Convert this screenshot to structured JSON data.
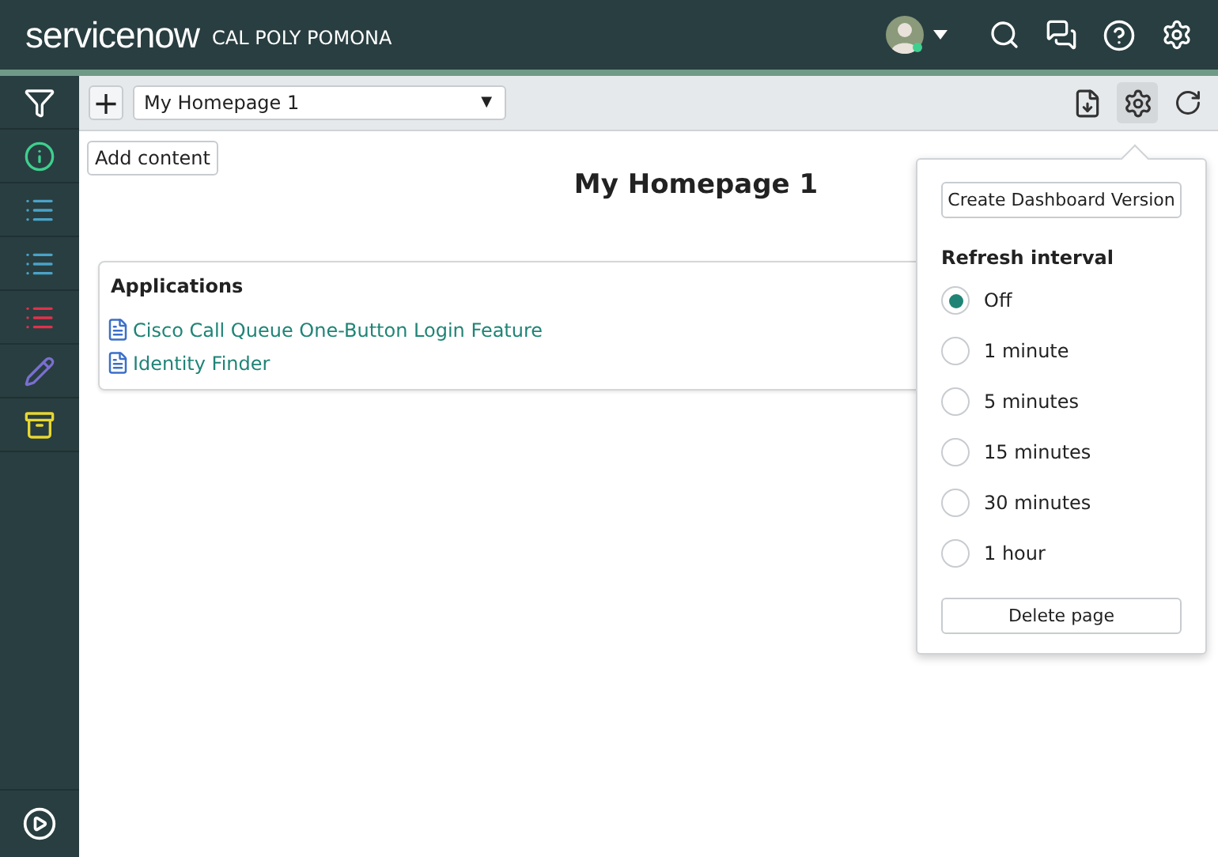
{
  "header": {
    "logo": "servicenow",
    "organization": "CAL POLY POMONA"
  },
  "sidebar": {
    "items": [
      {
        "kind": "filter",
        "color": "#ffffff"
      },
      {
        "kind": "info",
        "color": "#3fcf8e"
      },
      {
        "kind": "list",
        "color": "#4aa3c8"
      },
      {
        "kind": "list",
        "color": "#4aa3c8"
      },
      {
        "kind": "list",
        "color": "#e0324b"
      },
      {
        "kind": "pencil",
        "color": "#7a6fcf"
      },
      {
        "kind": "archive",
        "color": "#e7d832"
      }
    ]
  },
  "toolbar": {
    "add_button": "+",
    "homepage_select": {
      "value": "My Homepage 1",
      "caret": "▼"
    }
  },
  "content": {
    "add_content_button": "Add content",
    "title": "My Homepage 1",
    "card": {
      "title": "Applications",
      "links": [
        "Cisco Call Queue One-Button Login Feature",
        "Identity Finder"
      ]
    }
  },
  "popover": {
    "create_button": "Create Dashboard Version",
    "section_title": "Refresh interval",
    "options": [
      {
        "label": "Off",
        "selected": true
      },
      {
        "label": "1 minute",
        "selected": false
      },
      {
        "label": "5 minutes",
        "selected": false
      },
      {
        "label": "15 minutes",
        "selected": false
      },
      {
        "label": "30 minutes",
        "selected": false
      },
      {
        "label": "1 hour",
        "selected": false
      }
    ],
    "delete_button": "Delete page"
  }
}
